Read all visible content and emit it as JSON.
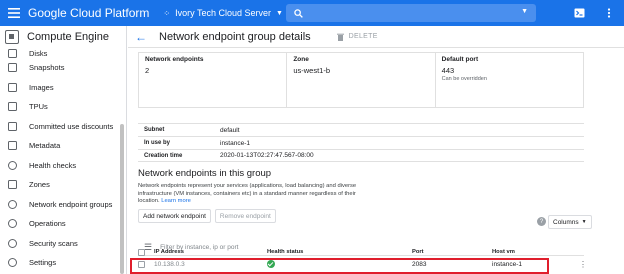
{
  "topbar": {
    "brand": "Google Cloud Platform",
    "project_name": "Ivory Tech Cloud Server",
    "icons": [
      "menu-icon",
      "project-dots-icon",
      "search-icon",
      "cloud-shell-icon",
      "notifications-icon"
    ]
  },
  "sidebar": {
    "title": "Compute Engine",
    "items": [
      {
        "label": "Disks"
      },
      {
        "label": "Snapshots"
      },
      {
        "label": "Images"
      },
      {
        "label": "TPUs"
      },
      {
        "label": "Committed use discounts"
      },
      {
        "label": "Metadata"
      },
      {
        "label": "Health checks"
      },
      {
        "label": "Zones"
      },
      {
        "label": "Network endpoint groups"
      },
      {
        "label": "Operations"
      },
      {
        "label": "Security scans"
      },
      {
        "label": "Settings"
      }
    ]
  },
  "header": {
    "title": "Network endpoint group details",
    "delete_label": "DELETE"
  },
  "summary": {
    "endpoints_label": "Network endpoints",
    "endpoints_value": "2",
    "zone_label": "Zone",
    "zone_value": "us-west1-b",
    "port_label": "Default port",
    "port_value": "443",
    "port_note": "Can be overridden"
  },
  "details": {
    "subnet_label": "Subnet",
    "subnet_value": "default",
    "inuse_label": "In use by",
    "inuse_value": "instance-1",
    "creation_label": "Creation time",
    "creation_value": "2020-01-13T02:27:47.567-08:00"
  },
  "section": {
    "title": "Network endpoints in this group",
    "description": "Network endpoints represent your services (applications, load balancing) and diverse infrastructure (VM instances, containers etc) in a standard manner regardless of their location.",
    "learn_more": "Learn more",
    "add_button": "Add network endpoint",
    "remove_button": "Remove endpoint"
  },
  "filter": {
    "placeholder": "Filter by instance, ip or port",
    "columns_label": "Columns"
  },
  "table": {
    "headers": {
      "ip": "IP Address",
      "health": "Health status",
      "port": "Port",
      "host": "Host vm"
    },
    "rows": [
      {
        "ip": "10.138.0.3",
        "health": "healthy",
        "port": "2083",
        "host": "instance-1"
      }
    ]
  },
  "colors": {
    "accent": "#1a73e8",
    "highlight": "#e01e2c",
    "ok": "#34a853"
  }
}
